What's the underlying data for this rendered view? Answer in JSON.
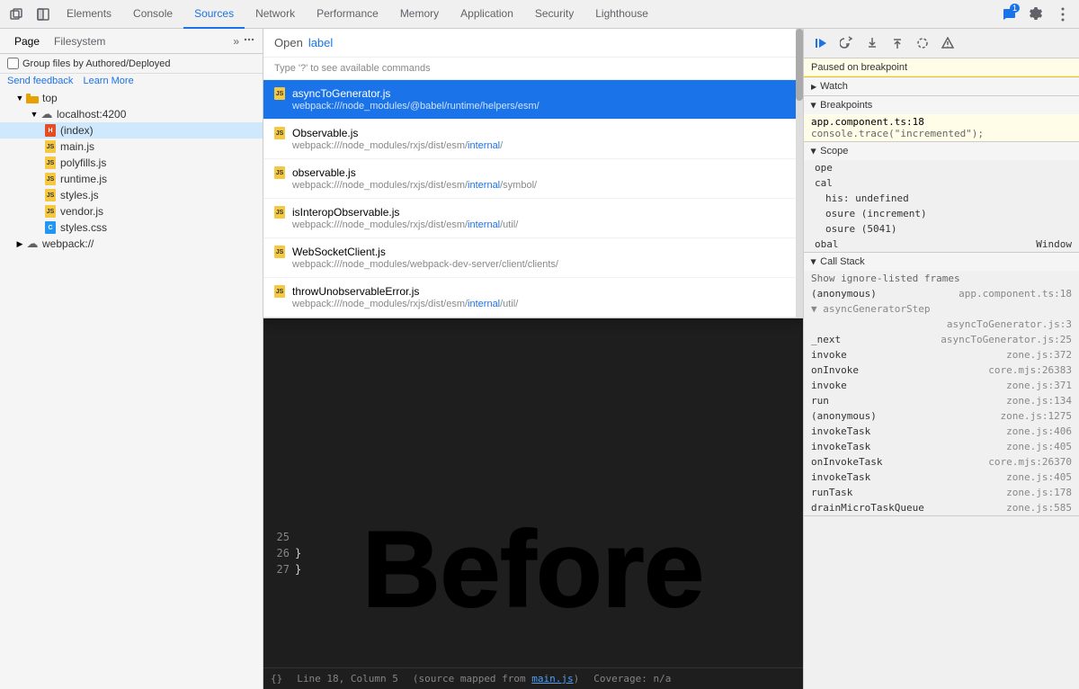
{
  "toolbar": {
    "tabs": [
      "Elements",
      "Console",
      "Sources",
      "Network",
      "Performance",
      "Memory",
      "Application",
      "Security",
      "Lighthouse"
    ],
    "active_tab": "Sources",
    "icons_left": [
      "restore-icon",
      "dock-icon"
    ],
    "icons_right": [
      "chat-icon",
      "settings-icon",
      "more-icon"
    ],
    "badge_count": "1"
  },
  "sub_toolbar": {
    "tabs": [
      "Page",
      "Filesystem"
    ],
    "active_tab": "Page",
    "more_icon": "more-tabs-icon"
  },
  "sidebar": {
    "group_files_label": "Group files by Authored/Deployed",
    "send_feedback": "Send feedback",
    "learn_more": "Learn More",
    "tree": {
      "top": {
        "label": "top",
        "children": {
          "localhost": {
            "label": "localhost:4200",
            "children": {
              "index": {
                "label": "(index)",
                "type": "html",
                "selected": true
              },
              "main": {
                "label": "main.js",
                "type": "js"
              },
              "polyfills": {
                "label": "polyfills.js",
                "type": "js"
              },
              "runtime": {
                "label": "runtime.js",
                "type": "js"
              },
              "styles_js": {
                "label": "styles.js",
                "type": "js"
              },
              "vendor": {
                "label": "vendor.js",
                "type": "js"
              },
              "styles_css": {
                "label": "styles.css",
                "type": "css"
              }
            }
          },
          "webpack": {
            "label": "webpack://",
            "type": "cloud"
          }
        }
      }
    }
  },
  "open_dialog": {
    "title_prefix": "Open",
    "input_value": "label",
    "hint": "Type '?' to see available commands",
    "results": [
      {
        "filename": "asyncToGenerator.js",
        "path": "webpack:///node_modules/@babel/runtime/helpers/esm/",
        "path_highlight_start": 38,
        "path_highlight_end": 41,
        "selected": true,
        "icon_color": "#f5c842"
      },
      {
        "filename": "Observable.js",
        "path": "webpack:///node_modules/rxjs/dist/esm/internal/",
        "path_highlight": "internal",
        "selected": false,
        "icon_color": "#f5c842"
      },
      {
        "filename": "observable.js",
        "path": "webpack:///node_modules/rxjs/dist/esm/internal/symbol/",
        "path_highlight": "internal",
        "selected": false,
        "icon_color": "#f5c842"
      },
      {
        "filename": "isInteropObservable.js",
        "path": "webpack:///node_modules/rxjs/dist/esm/internal/util/",
        "path_highlight": "internal",
        "selected": false,
        "icon_color": "#f5c842"
      },
      {
        "filename": "WebSocketClient.js",
        "path": "webpack:///node_modules/webpack-dev-server/client/clients/",
        "selected": false,
        "icon_color": "#f5c842"
      },
      {
        "filename": "throwUnobservableError.js",
        "path": "webpack:///node_modules/rxjs/dist/esm/internal/util/",
        "path_highlight": "internal",
        "selected": false,
        "icon_color": "#f5c842"
      }
    ]
  },
  "code_editor": {
    "lines": [
      {
        "num": 25,
        "code": "  }"
      },
      {
        "num": 26,
        "code": "}"
      },
      {
        "num": 27,
        "code": ""
      }
    ],
    "status_bar": {
      "position": "Line 18, Column 5",
      "source_map": "(source mapped from main.js)",
      "coverage": "Coverage: n/a"
    },
    "watermark": "Before"
  },
  "right_panel": {
    "debug_buttons": [
      "resume-icon",
      "step-over-icon",
      "step-into-icon",
      "step-out-icon",
      "deactivate-icon",
      "pause-on-exception-icon"
    ],
    "paused_label": "Paused on breakpoint",
    "watch_label": "Watch",
    "breakpoints_label": "Breakpoints",
    "breakpoint_file": "app.component.ts:18",
    "breakpoint_code": "console.trace(\"incremented\");",
    "scope_label": "Scope",
    "scope_items": [
      {
        "label": "ope"
      },
      {
        "label": "cal"
      },
      {
        "label": "his: undefined",
        "indent": 1
      },
      {
        "label": "osure (increment)",
        "indent": 1
      },
      {
        "label": "osure (5041)",
        "indent": 1
      },
      {
        "label": "obal",
        "suffix": "Window"
      }
    ],
    "call_stack_label": "Call Stack",
    "show_ignored_frames": "Show ignore-listed frames",
    "call_stack": [
      {
        "fn": "(anonymous)",
        "loc": "app.component.ts:18"
      },
      {
        "fn": "▼ asyncGeneratorStep",
        "loc": ""
      },
      {
        "fn": "",
        "loc": "asyncToGenerator.js:3"
      },
      {
        "fn": "_next",
        "loc": "asyncToGenerator.js:25"
      },
      {
        "fn": "invoke",
        "loc": "zone.js:372"
      },
      {
        "fn": "onInvoke",
        "loc": "core.mjs:26383"
      },
      {
        "fn": "invoke",
        "loc": "zone.js:371"
      },
      {
        "fn": "run",
        "loc": "zone.js:134"
      },
      {
        "fn": "(anonymous)",
        "loc": "zone.js:1275"
      },
      {
        "fn": "invokeTask",
        "loc": "zone.js:406"
      },
      {
        "fn": "invokeTask",
        "loc": "zone.js:405"
      },
      {
        "fn": "onInvokeTask",
        "loc": "core.mjs:26370"
      },
      {
        "fn": "invokeTask",
        "loc": "zone.js:405"
      },
      {
        "fn": "runTask",
        "loc": "zone.js:178"
      },
      {
        "fn": "drainMicroTaskQueue",
        "loc": "zone.js:585"
      }
    ]
  }
}
